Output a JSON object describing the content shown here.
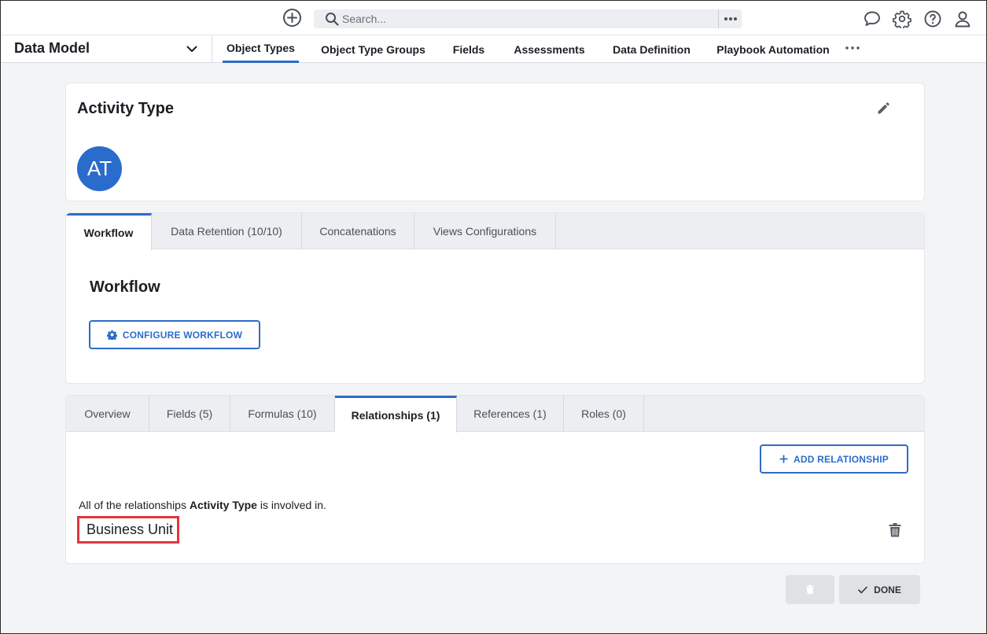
{
  "topbar": {
    "add_icon": "plus-circle-icon",
    "search_placeholder": "Search...",
    "icons": [
      "chat-icon",
      "gear-icon",
      "help-icon",
      "user-icon"
    ]
  },
  "app": {
    "title": "Data Model"
  },
  "nav": {
    "tabs": [
      {
        "label": "Object Types",
        "active": true
      },
      {
        "label": "Object Type Groups"
      },
      {
        "label": "Fields"
      },
      {
        "label": "Assessments"
      },
      {
        "label": "Data Definition"
      },
      {
        "label": "Playbook Automation"
      }
    ]
  },
  "record": {
    "title": "Activity Type",
    "avatar_initials": "AT"
  },
  "config_tabs": {
    "tabs": [
      {
        "label": "Workflow",
        "active": true
      },
      {
        "label": "Data Retention (10/10)"
      },
      {
        "label": "Concatenations"
      },
      {
        "label": "Views Configurations"
      }
    ],
    "section_title": "Workflow",
    "configure_button": "CONFIGURE WORKFLOW"
  },
  "detail_tabs": {
    "tabs": [
      {
        "label": "Overview"
      },
      {
        "label": "Fields (5)"
      },
      {
        "label": "Formulas (10)"
      },
      {
        "label": "Relationships (1)",
        "active": true
      },
      {
        "label": "References (1)"
      },
      {
        "label": "Roles (0)"
      }
    ],
    "add_button": "ADD RELATIONSHIP",
    "description_prefix": "All of the relationships ",
    "description_subject": "Activity Type",
    "description_suffix": " is involved in.",
    "relationships": [
      "Business Unit"
    ]
  },
  "footer": {
    "done_label": "DONE"
  },
  "colors": {
    "accent": "#2d6cc9",
    "avatar": "#2a6ccc",
    "highlight": "#e0373d"
  }
}
